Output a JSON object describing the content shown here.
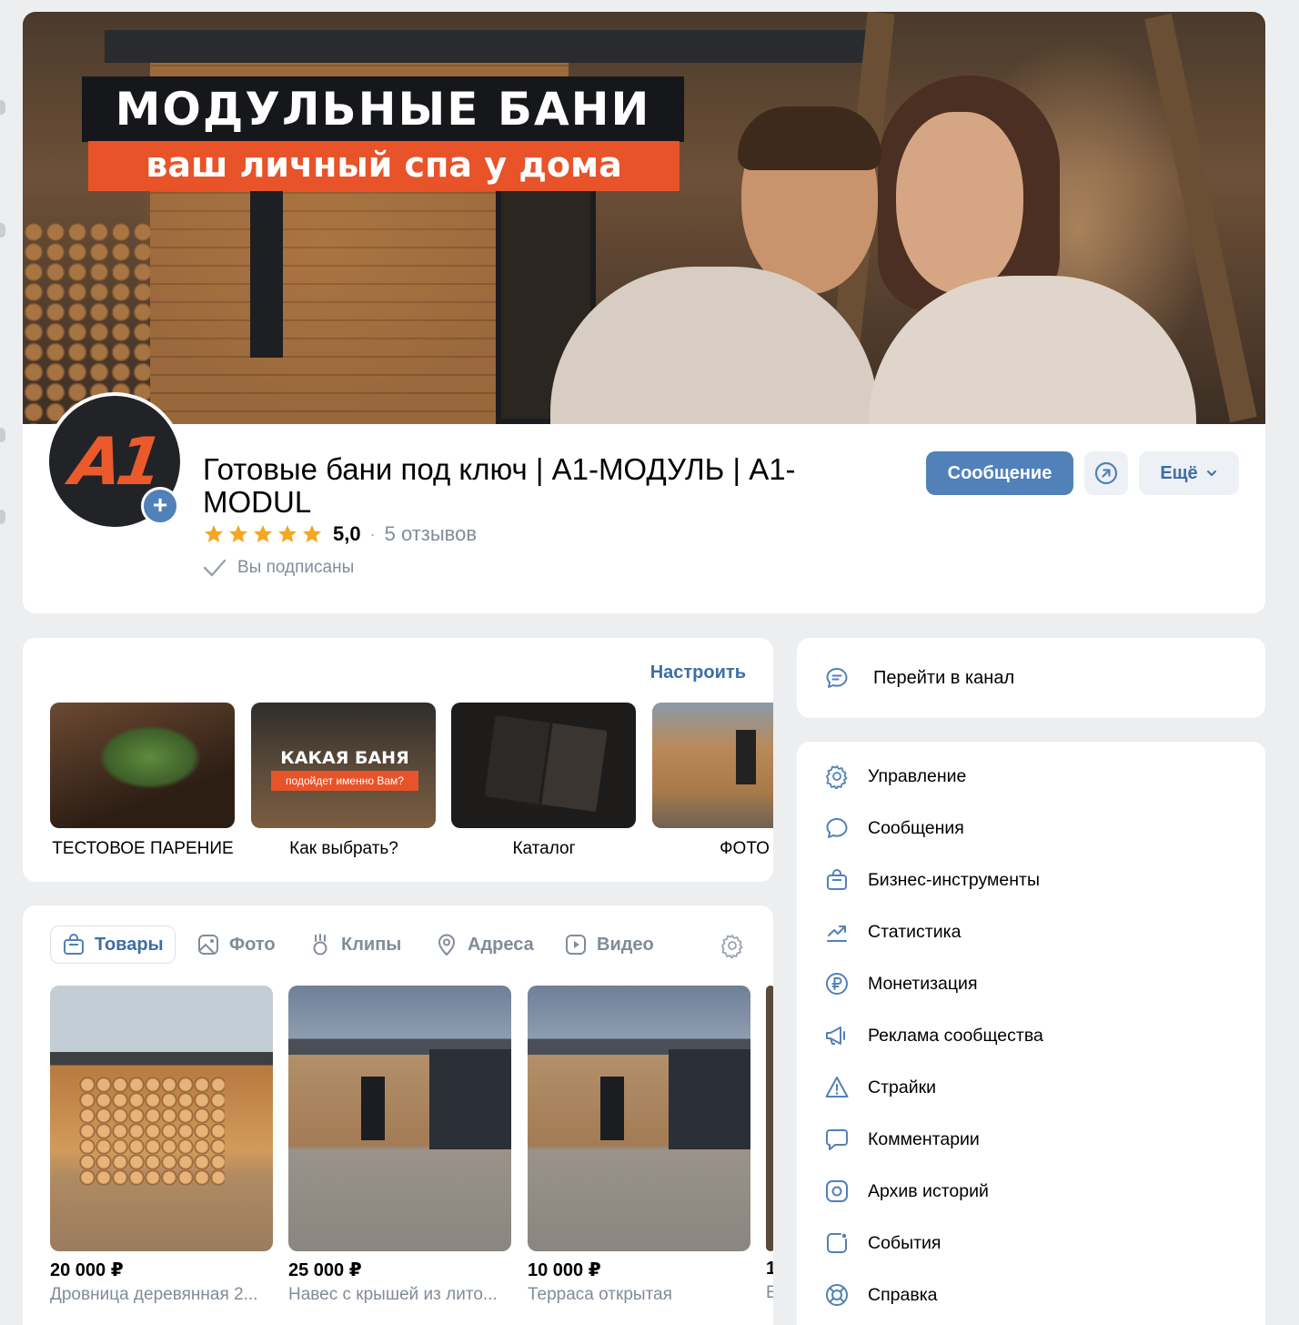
{
  "cover": {
    "title": "МОДУЛЬНЫЕ БАНИ",
    "subtitle": "ваш личный спа у дома"
  },
  "group": {
    "avatar_text": "A1",
    "name": "Готовые бани под ключ | А1-МОДУЛЬ | А1-MODUL",
    "rating_value": "5,0",
    "rating_stars": 5,
    "reviews": "5 отзывов",
    "subscribed": "Вы подписаны"
  },
  "actions": {
    "message": "Сообщение",
    "more": "Ещё",
    "share_icon": "share-arrow-icon"
  },
  "albums": {
    "settings": "Настроить",
    "items": [
      {
        "label": "ТЕСТОВОЕ ПАРЕНИЕ"
      },
      {
        "label": "Как выбрать?",
        "thumb_title": "КАКАЯ БАНЯ",
        "thumb_sub": "подойдет именно Вам?"
      },
      {
        "label": "Каталог"
      },
      {
        "label": "ФОТО"
      }
    ]
  },
  "tabs": [
    {
      "label": "Товары",
      "icon": "bag-icon",
      "active": true
    },
    {
      "label": "Фото",
      "icon": "image-icon"
    },
    {
      "label": "Клипы",
      "icon": "clips-icon"
    },
    {
      "label": "Адреса",
      "icon": "location-icon"
    },
    {
      "label": "Видео",
      "icon": "video-icon"
    }
  ],
  "products": [
    {
      "price": "20 000 ₽",
      "desc": "Дровница деревянная 2..."
    },
    {
      "price": "25 000 ₽",
      "desc": "Навес с крышей из лито..."
    },
    {
      "price": "10 000 ₽",
      "desc": "Терраса открытая"
    },
    {
      "price": "1",
      "desc": "Е"
    }
  ],
  "channel": {
    "label": "Перейти в канал",
    "icon": "chat-bubble-icon"
  },
  "menu": [
    {
      "label": "Управление",
      "icon": "gear-icon"
    },
    {
      "label": "Сообщения",
      "icon": "message-icon"
    },
    {
      "label": "Бизнес-инструменты",
      "icon": "briefcase-icon"
    },
    {
      "label": "Статистика",
      "icon": "chart-icon"
    },
    {
      "label": "Монетизация",
      "icon": "ruble-icon"
    },
    {
      "label": "Реклама сообщества",
      "icon": "megaphone-icon"
    },
    {
      "label": "Страйки",
      "icon": "warning-icon"
    },
    {
      "label": "Комментарии",
      "icon": "comment-icon"
    },
    {
      "label": "Архив историй",
      "icon": "story-archive-icon"
    },
    {
      "label": "События",
      "icon": "event-icon"
    },
    {
      "label": "Справка",
      "icon": "help-icon"
    }
  ],
  "colors": {
    "accent": "#5181b8",
    "link": "#3d6ea6",
    "star": "#f5a623",
    "banner_orange": "#e8532a",
    "secondary_text": "#818c99",
    "background": "#edeef0"
  }
}
